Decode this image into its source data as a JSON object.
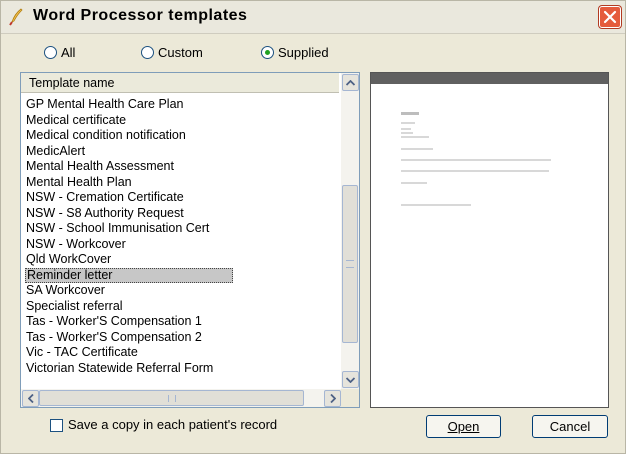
{
  "window": {
    "title": "Word Processor templates",
    "accent": "#e55b3c"
  },
  "filter": {
    "options": [
      {
        "label": "All",
        "selected": false
      },
      {
        "label": "Custom",
        "selected": false
      },
      {
        "label": "Supplied",
        "selected": true
      }
    ]
  },
  "list": {
    "header": "Template name",
    "rows": [
      {
        "label": "GP Mental Health Care Plan",
        "selected": false
      },
      {
        "label": "Medical certificate",
        "selected": false
      },
      {
        "label": "Medical condition notification",
        "selected": false
      },
      {
        "label": "MedicAlert",
        "selected": false
      },
      {
        "label": "Mental Health Assessment",
        "selected": false
      },
      {
        "label": "Mental Health Plan",
        "selected": false
      },
      {
        "label": "NSW - Cremation Certificate",
        "selected": false
      },
      {
        "label": "NSW - S8 Authority Request",
        "selected": false
      },
      {
        "label": "NSW - School Immunisation Cert",
        "selected": false
      },
      {
        "label": "NSW - Workcover",
        "selected": false
      },
      {
        "label": "Qld WorkCover",
        "selected": false
      },
      {
        "label": "Reminder letter",
        "selected": true
      },
      {
        "label": "SA Workcover",
        "selected": false
      },
      {
        "label": "Specialist referral",
        "selected": false
      },
      {
        "label": "Tas - Worker'S Compensation 1",
        "selected": false
      },
      {
        "label": "Tas - Worker'S Compensation 2",
        "selected": false
      },
      {
        "label": "Vic - TAC Certificate",
        "selected": false
      },
      {
        "label": "Victorian Statewide Referral Form",
        "selected": false
      }
    ]
  },
  "footer": {
    "save_copy_label": "Save a copy in each patient's record",
    "save_copy_checked": false,
    "open_label": "Open",
    "cancel_label": "Cancel"
  }
}
